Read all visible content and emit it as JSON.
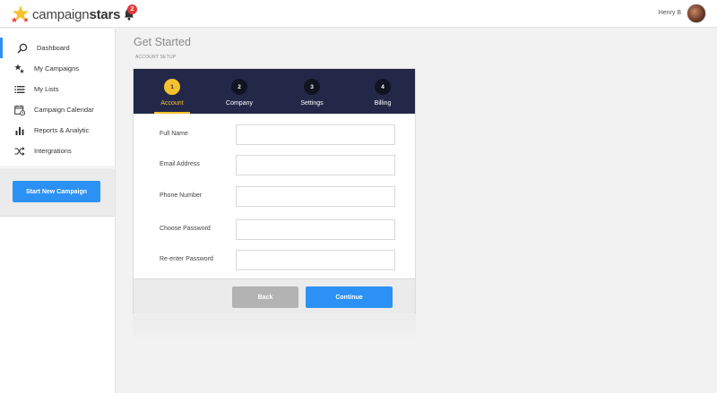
{
  "header": {
    "brand_light": "campaign",
    "brand_bold": "stars",
    "notification_count": "2",
    "user_name": "Henry B"
  },
  "sidebar": {
    "items": [
      {
        "label": "Dashboard",
        "icon": "magnifier-icon",
        "active": true
      },
      {
        "label": "My Campaigns",
        "icon": "stars-icon",
        "active": false
      },
      {
        "label": "My Lists",
        "icon": "list-icon",
        "active": false
      },
      {
        "label": "Campaign Calendar",
        "icon": "calendar-icon",
        "active": false
      },
      {
        "label": "Reports & Analytic",
        "icon": "bar-chart-icon",
        "active": false
      },
      {
        "label": "Intergrations",
        "icon": "shuffle-icon",
        "active": false
      }
    ],
    "cta_label": "Start New Campaign"
  },
  "main": {
    "title": "Get Started",
    "breadcrumb": "ACCOUNT SETUP",
    "steps": [
      {
        "num": "1",
        "label": "Account",
        "active": true
      },
      {
        "num": "2",
        "label": "Company",
        "active": false
      },
      {
        "num": "3",
        "label": "Settings",
        "active": false
      },
      {
        "num": "4",
        "label": "Billing",
        "active": false
      }
    ],
    "fields": [
      {
        "label": "Full Name",
        "value": ""
      },
      {
        "label": "Email Address",
        "value": ""
      },
      {
        "label": "Phone Number",
        "value": ""
      },
      {
        "label": "Choose Password",
        "value": ""
      },
      {
        "label": "Re-enter Password",
        "value": ""
      }
    ],
    "back_label": "Back",
    "continue_label": "Continue"
  },
  "colors": {
    "accent": "#2c91f5",
    "step_bar": "#232848",
    "step_active": "#f6c12d",
    "badge": "#e5383b"
  }
}
